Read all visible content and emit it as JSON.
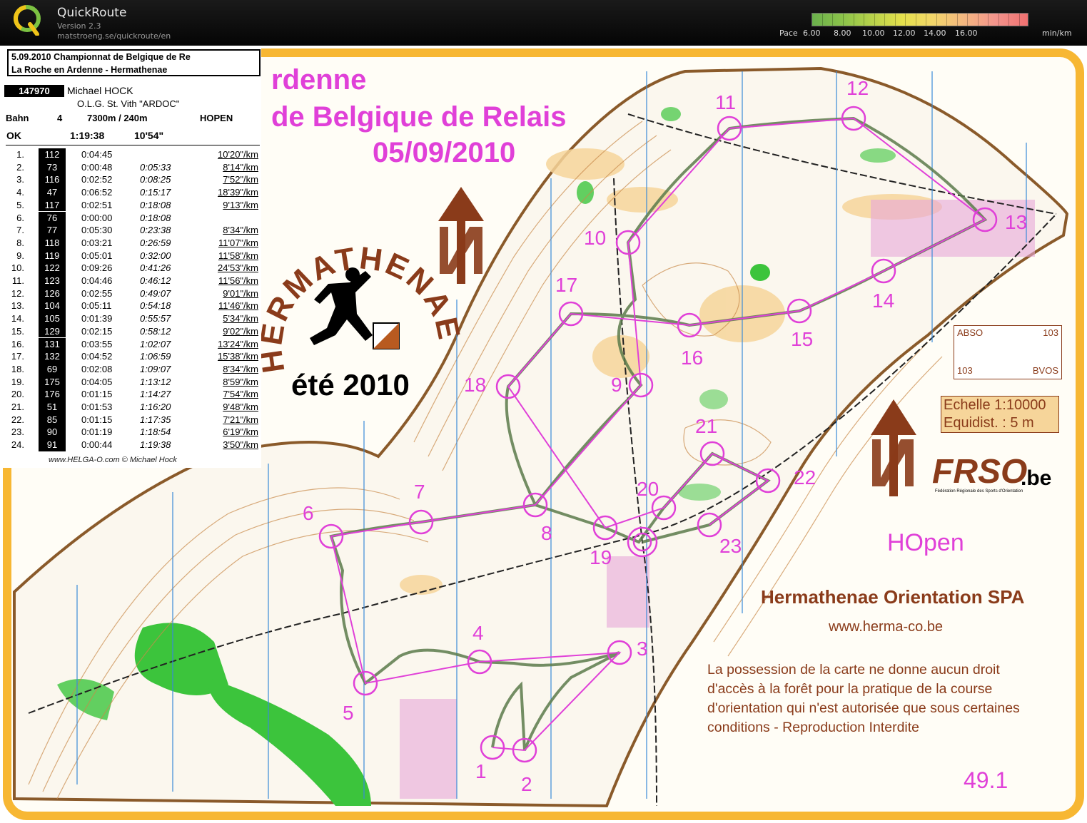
{
  "app": {
    "name": "QuickRoute",
    "version": "Version 2.3",
    "url": "matstroeng.se/quickroute/en"
  },
  "pace_scale": {
    "label": "Pace",
    "ticks": [
      "6.00",
      "8.00",
      "10.00",
      "12.00",
      "14.00",
      "16.00"
    ],
    "unit": "min/km"
  },
  "panel": {
    "event_line1": "5.09.2010   Championnat de Belgique de Re",
    "event_line2": "La Roche en Ardenne - Hermathenae",
    "runner_id": "147970",
    "runner_name": "Michael HOCK",
    "club": "O.L.G. St. Vith \"ARDOC\"",
    "course_label": "Bahn",
    "course_no": "4",
    "course_length": "7300m / 240m",
    "course_name": "HOPEN",
    "status": "OK",
    "total_time": "1:19:38",
    "avg_pace": "10'54\"",
    "splits": [
      {
        "n": "1.",
        "ctrl": "112",
        "leg": "0:04:45",
        "cum": "",
        "pace": "10'20\"/km"
      },
      {
        "n": "2.",
        "ctrl": "73",
        "leg": "0:00:48",
        "cum": "0:05:33",
        "pace": "8'14\"/km"
      },
      {
        "n": "3.",
        "ctrl": "116",
        "leg": "0:02:52",
        "cum": "0:08:25",
        "pace": "7'52\"/km"
      },
      {
        "n": "4.",
        "ctrl": "47",
        "leg": "0:06:52",
        "cum": "0:15:17",
        "pace": "18'39\"/km"
      },
      {
        "n": "5.",
        "ctrl": "117",
        "leg": "0:02:51",
        "cum": "0:18:08",
        "pace": "9'13\"/km"
      },
      {
        "n": "6.",
        "ctrl": "76",
        "leg": "0:00:00",
        "cum": "0:18:08",
        "pace": ""
      },
      {
        "n": "7.",
        "ctrl": "77",
        "leg": "0:05:30",
        "cum": "0:23:38",
        "pace": "8'34\"/km"
      },
      {
        "n": "8.",
        "ctrl": "118",
        "leg": "0:03:21",
        "cum": "0:26:59",
        "pace": "11'07\"/km"
      },
      {
        "n": "9.",
        "ctrl": "119",
        "leg": "0:05:01",
        "cum": "0:32:00",
        "pace": "11'58\"/km"
      },
      {
        "n": "10.",
        "ctrl": "122",
        "leg": "0:09:26",
        "cum": "0:41:26",
        "pace": "24'53\"/km"
      },
      {
        "n": "11.",
        "ctrl": "123",
        "leg": "0:04:46",
        "cum": "0:46:12",
        "pace": "11'56\"/km"
      },
      {
        "n": "12.",
        "ctrl": "126",
        "leg": "0:02:55",
        "cum": "0:49:07",
        "pace": "9'01\"/km"
      },
      {
        "n": "13.",
        "ctrl": "104",
        "leg": "0:05:11",
        "cum": "0:54:18",
        "pace": "11'46\"/km"
      },
      {
        "n": "14.",
        "ctrl": "105",
        "leg": "0:01:39",
        "cum": "0:55:57",
        "pace": "5'34\"/km"
      },
      {
        "n": "15.",
        "ctrl": "129",
        "leg": "0:02:15",
        "cum": "0:58:12",
        "pace": "9'02\"/km"
      },
      {
        "n": "16.",
        "ctrl": "131",
        "leg": "0:03:55",
        "cum": "1:02:07",
        "pace": "13'24\"/km"
      },
      {
        "n": "17.",
        "ctrl": "132",
        "leg": "0:04:52",
        "cum": "1:06:59",
        "pace": "15'38\"/km"
      },
      {
        "n": "18.",
        "ctrl": "69",
        "leg": "0:02:08",
        "cum": "1:09:07",
        "pace": "8'34\"/km"
      },
      {
        "n": "19.",
        "ctrl": "175",
        "leg": "0:04:05",
        "cum": "1:13:12",
        "pace": "8'59\"/km"
      },
      {
        "n": "20.",
        "ctrl": "176",
        "leg": "0:01:15",
        "cum": "1:14:27",
        "pace": "7'54\"/km"
      },
      {
        "n": "21.",
        "ctrl": "51",
        "leg": "0:01:53",
        "cum": "1:16:20",
        "pace": "9'48\"/km"
      },
      {
        "n": "22.",
        "ctrl": "85",
        "leg": "0:01:15",
        "cum": "1:17:35",
        "pace": "7'21\"/km"
      },
      {
        "n": "23.",
        "ctrl": "90",
        "leg": "0:01:19",
        "cum": "1:18:54",
        "pace": "6'19\"/km"
      },
      {
        "n": "24.",
        "ctrl": "91",
        "leg": "0:00:44",
        "cum": "1:19:38",
        "pace": "3'50\"/km"
      }
    ],
    "credit": "www.HELGA-O.com © Michael Hock"
  },
  "map": {
    "title_line1": "rdenne",
    "title_line2": "de Belgique de Relais",
    "title_line3": "05/09/2010",
    "club_logo_text": "HERMATHENAE",
    "club_logo_year": "été 2010",
    "category": "HOpen",
    "organizer": "Hermathenae Orientation SPA",
    "organizer_url": "www.herma-co.be",
    "disclaimer_lines": [
      "La possession de la carte ne donne aucun droit",
      "d'accès à la forêt pour la pratique de la course",
      "d'orientation qui n'est autorisée que sous certaines",
      "conditions -  Reproduction Interdite"
    ],
    "scale": "Echelle 1:10000",
    "equidistance": "Equidist. : 5 m",
    "abso_tl": "ABSO",
    "abso_tr": "103",
    "abso_bl": "103",
    "abso_br": "BVOS",
    "frso_logo": "FRSO",
    "frso_suffix": ".be",
    "frso_caption": "Fédération Régionale des Sports d'Orientation",
    "map_number": "49.1",
    "control_labels": [
      "1",
      "2",
      "3",
      "4",
      "5",
      "6",
      "7",
      "8",
      "9",
      "10",
      "11",
      "12",
      "13",
      "14",
      "15",
      "16",
      "17",
      "18",
      "19",
      "20",
      "21",
      "22",
      "23"
    ],
    "colors": {
      "course": "#e040d8",
      "route": "#5a7a4a",
      "contour": "#b5703a",
      "forest_green": "#3cc43c",
      "open_yellow": "#f6d59a",
      "border_orange": "#f7b733",
      "north_brown": "#8a3b1a"
    }
  }
}
